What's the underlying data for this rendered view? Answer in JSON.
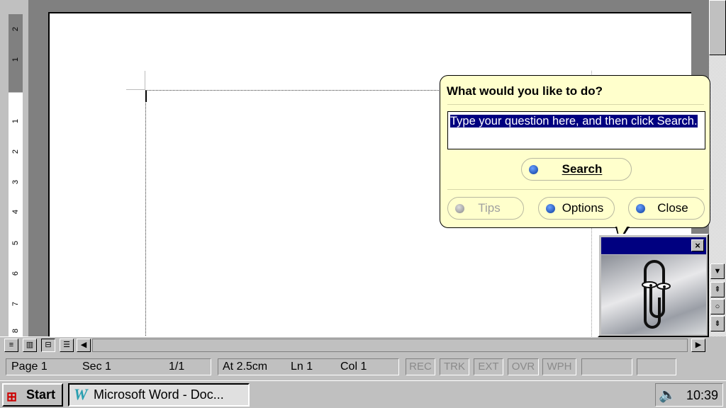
{
  "ruler": {
    "numbers_gray": [
      "2",
      "1"
    ],
    "numbers_white": [
      "1",
      "2",
      "3",
      "4",
      "5",
      "6",
      "7",
      "8"
    ]
  },
  "scrollbar": {
    "up_arrow": "▲",
    "down_arrow": "▼",
    "prev_page": "⇞",
    "select_browse": "○",
    "next_page": "⇟"
  },
  "view_buttons": [
    "normal-view",
    "web-layout-view",
    "print-layout-view",
    "outline-view"
  ],
  "status": {
    "page": "Page 1",
    "sec": "Sec 1",
    "pages": "1/1",
    "at": "At 2.5cm",
    "ln": "Ln 1",
    "col": "Col 1",
    "rec": "REC",
    "trk": "TRK",
    "ext": "EXT",
    "ovr": "OVR",
    "wph": "WPH"
  },
  "taskbar": {
    "start": "Start",
    "task": "Microsoft Word - Doc...",
    "clock": "10:39"
  },
  "assistant": {
    "title": "What would you like to do?",
    "query": "Type your question here, and then click Search.",
    "search": "Search",
    "tips": "Tips",
    "options": "Options",
    "close": "Close",
    "close_x": "×"
  },
  "colors": {
    "title_bar": "#000080",
    "balloon": "#ffffcc",
    "selection": "#000080"
  }
}
